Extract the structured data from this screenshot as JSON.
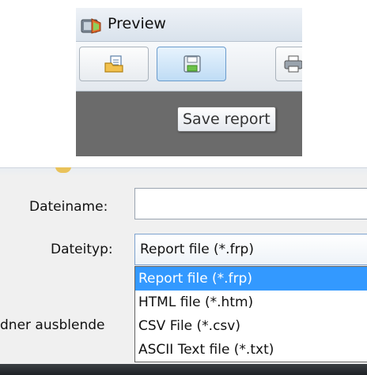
{
  "preview_window": {
    "title": "Preview",
    "icons": {
      "app": "app-icon",
      "open": "open-report-icon",
      "save": "save-icon",
      "print": "print-icon"
    },
    "tooltip": "Save report"
  },
  "save_dialog": {
    "filename_label": "Dateiname:",
    "filename_value": "",
    "filetype_label": "Dateityp:",
    "filetype_selected": "Report file (*.frp)",
    "filetype_options": [
      "Report file (*.frp)",
      "HTML file (*.htm)",
      "CSV File (*.csv)",
      "ASCII Text file (*.txt)"
    ],
    "hide_folders_label": "dner ausblende"
  },
  "colors": {
    "selection": "#3399ff",
    "hover_button": "#bfdcf5",
    "preview_background": "#6b6b6b"
  }
}
